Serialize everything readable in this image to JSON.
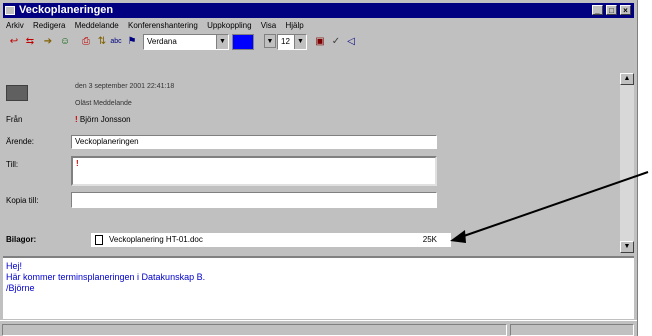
{
  "window": {
    "title": "Veckoplaneringen"
  },
  "menu": [
    "Arkiv",
    "Redigera",
    "Meddelande",
    "Konferenshantering",
    "Uppkoppling",
    "Visa",
    "Hjälp"
  ],
  "toolbar": {
    "font": "Verdana",
    "size": "12",
    "font_color": "#0000ff"
  },
  "message": {
    "date": "den 3 september 2001 22:41:18",
    "status": "Oläst Meddelande",
    "from_label": "Från",
    "from_value": "Björn Jonsson",
    "subject_label": "Ärende:",
    "subject_value": "Veckoplaneringen",
    "to_label": "Till:",
    "cc_label": "Kopia till:",
    "attach_label": "Bilagor:",
    "attachment_name": "Veckoplanering HT-01.doc",
    "attachment_size": "25K"
  },
  "body": {
    "lines": [
      "Hej!",
      "Här kommer terminsplaneringen i Datakunskap B.",
      "/Björne"
    ],
    "text_color": "#0000cc"
  }
}
